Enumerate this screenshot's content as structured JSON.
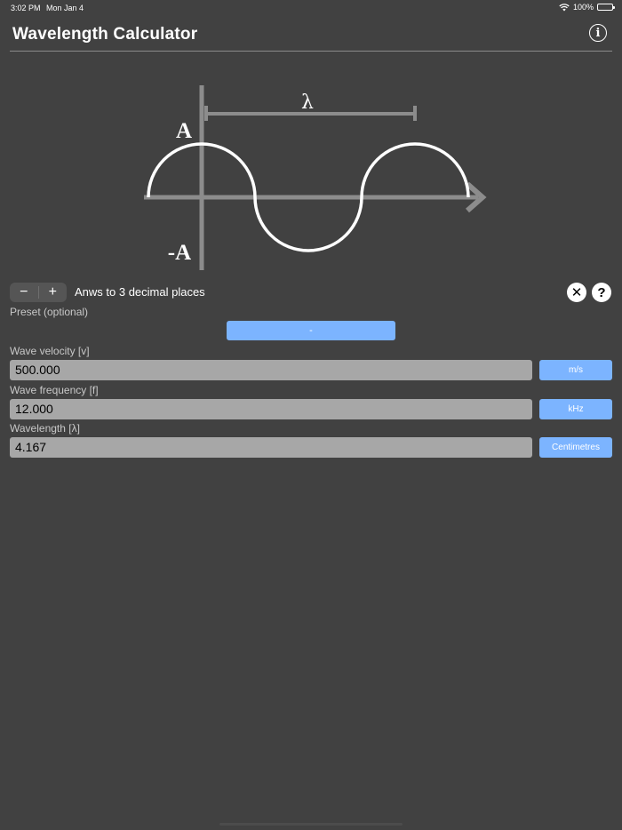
{
  "status_bar": {
    "time": "3:02 PM",
    "date": "Mon Jan 4",
    "battery": "100%"
  },
  "app": {
    "title": "Wavelength Calculator"
  },
  "diagram": {
    "lambda_label": "λ",
    "amplitude_label": "A",
    "neg_amplitude_label": "-A"
  },
  "controls": {
    "minus": "−",
    "plus": "+",
    "decimal_text": "Anws to 3 decimal places",
    "clear": "✕",
    "help": "?"
  },
  "preset": {
    "label": "Preset (optional)",
    "value": "-"
  },
  "fields": [
    {
      "label": "Wave velocity [v]",
      "value": "500.000",
      "unit": "m/s"
    },
    {
      "label": "Wave frequency [f]",
      "value": "12.000",
      "unit": "kHz"
    },
    {
      "label": "Wavelength [λ]",
      "value": "4.167",
      "unit": "Centimetres"
    }
  ],
  "colors": {
    "background": "#414141",
    "accent": "#7cb4ff",
    "field": "#a7a7a7"
  }
}
